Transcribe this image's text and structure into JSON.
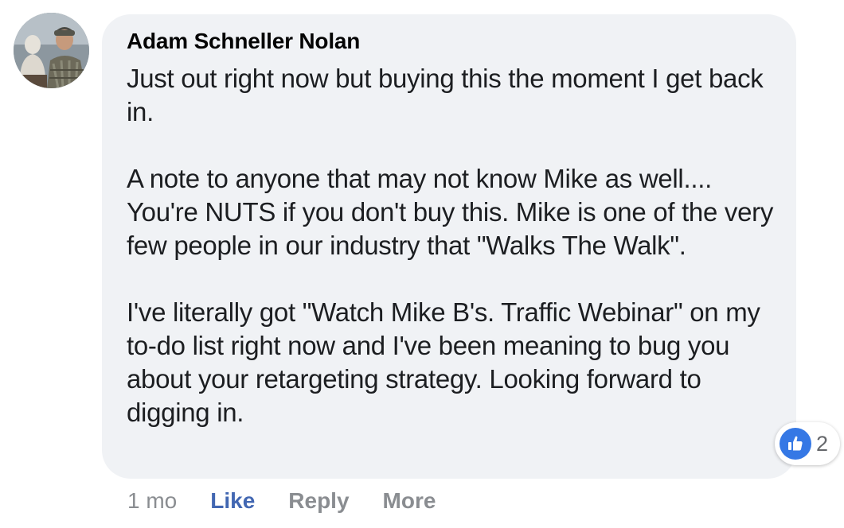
{
  "comment": {
    "author": "Adam Schneller Nolan",
    "paragraphs": [
      "Just out right now but buying this the moment I get back in.",
      "A note to anyone that may not know Mike as well.... You're NUTS if you don't buy this. Mike is one of the very few people in our industry that \"Walks The Walk\".",
      "I've literally got \"Watch Mike B's. Traffic Webinar\" on my to-do list right now and I've been meaning to bug you about your retargeting strategy. Looking forward to digging in."
    ],
    "reaction_icon": "like-icon",
    "reaction_count": "2",
    "accent_color": "#4267b2",
    "bubble_color": "#f0f2f5"
  },
  "actions": {
    "timestamp": "1 mo",
    "like_label": "Like",
    "reply_label": "Reply",
    "more_label": "More"
  }
}
